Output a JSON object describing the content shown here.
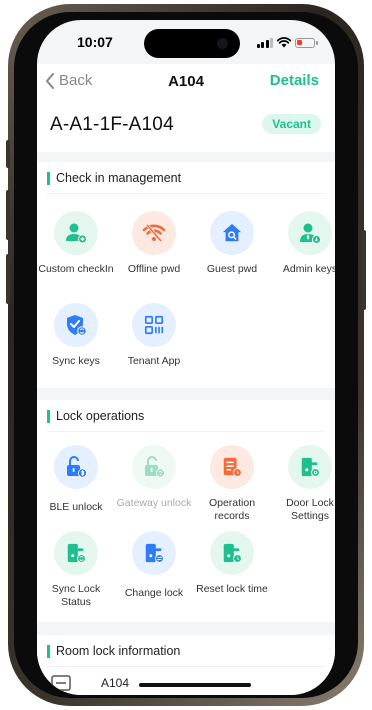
{
  "status": {
    "time": "10:07"
  },
  "nav": {
    "back": "Back",
    "title": "A104",
    "right": "Details"
  },
  "room": {
    "name": "A-A1-1F-A104",
    "status": "Vacant"
  },
  "sections": {
    "checkin": {
      "title": "Check in management",
      "items": [
        {
          "label": "Custom checkIn",
          "icon": "person-add-icon"
        },
        {
          "label": "Offline pwd",
          "icon": "wifi-off-icon"
        },
        {
          "label": "Guest pwd",
          "icon": "home-key-icon"
        },
        {
          "label": "Admin keys",
          "icon": "admin-key-icon"
        },
        {
          "label": "Sync keys",
          "icon": "shield-sync-icon"
        },
        {
          "label": "Tenant App",
          "icon": "qr-code-icon"
        }
      ]
    },
    "lock": {
      "title": "Lock operations",
      "items": [
        {
          "label": "BLE unlock",
          "icon": "bluetooth-unlock-icon"
        },
        {
          "label": "Gateway unlock",
          "icon": "gateway-unlock-icon"
        },
        {
          "label": "Operation records",
          "icon": "records-icon"
        },
        {
          "label": "Door Lock Settings",
          "icon": "lock-settings-icon"
        },
        {
          "label": "Sync Lock Status",
          "icon": "sync-lock-icon"
        },
        {
          "label": "Change lock",
          "icon": "change-lock-icon"
        },
        {
          "label": "Reset lock time",
          "icon": "reset-time-icon"
        }
      ]
    },
    "roomlock": {
      "title": "Room lock information",
      "first_row": "A104"
    }
  },
  "colors": {
    "accent": "#1fbf8f",
    "orange": "#f26b3a",
    "blue": "#2f7df6"
  }
}
